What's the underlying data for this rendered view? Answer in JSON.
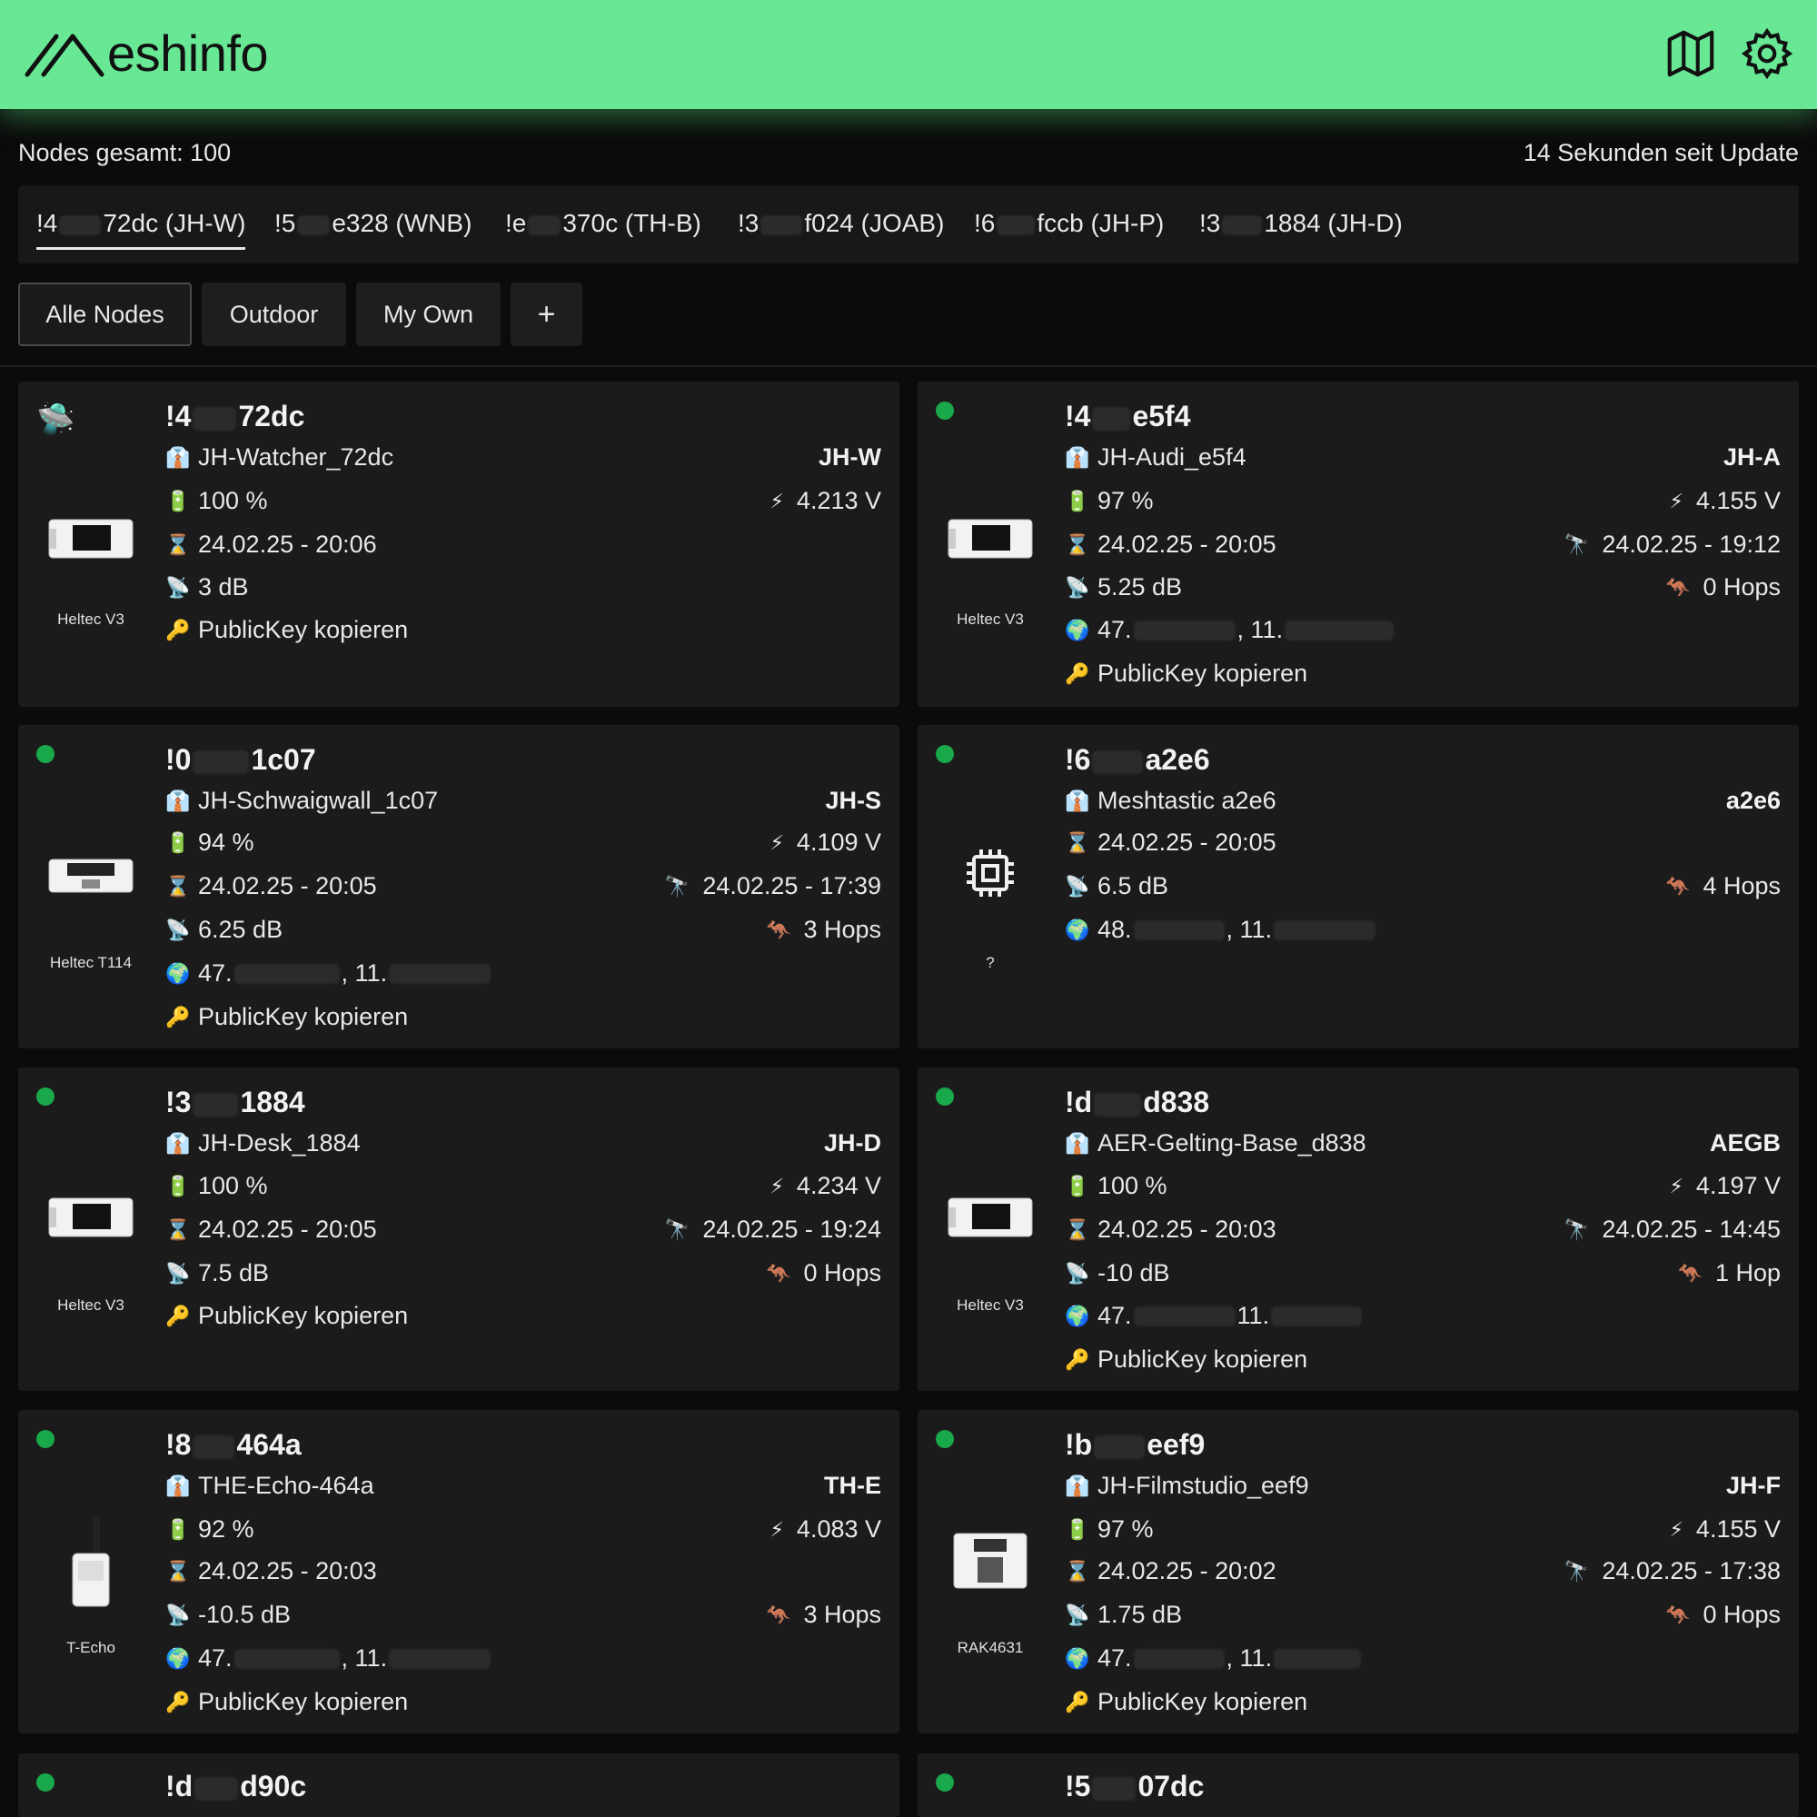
{
  "app": {
    "title": "eshinfo",
    "nodes_total": "Nodes gesamt: 100",
    "last_update": "14 Sekunden seit Update"
  },
  "icons": {
    "map": "map-icon",
    "settings": "settings-icon",
    "accent": "#68e895",
    "online": "#19a84a"
  },
  "favorites": [
    {
      "pre": "!4",
      "post": "72dc (JH-W)"
    },
    {
      "pre": "!5",
      "post": "e328 (WNB)"
    },
    {
      "pre": "!e",
      "post": "370c (TH-B)"
    },
    {
      "pre": "!3",
      "post": "f024 (JOAB)"
    },
    {
      "pre": "!6",
      "post": "fccb (JH-P)"
    },
    {
      "pre": "!3",
      "post": "1884 (JH-D)"
    }
  ],
  "filters": [
    "Alle Nodes",
    "Outdoor",
    "My Own",
    "+"
  ],
  "nodes": [
    {
      "id_pre": "!4",
      "id_post": "72dc",
      "name": "JH-Watcher_72dc",
      "short": "JH-W",
      "battery": "100 %",
      "voltage": "4.213 V",
      "last_heard": "24.02.25 - 20:06",
      "snr": "3 dB",
      "pubkey": "PublicKey kopieren",
      "device": "Heltec V3"
    },
    {
      "id_pre": "!4",
      "id_post": "e5f4",
      "name": "JH-Audi_e5f4",
      "short": "JH-A",
      "battery": "97 %",
      "voltage": "4.155 V",
      "last_heard": "24.02.25 - 20:05",
      "position_time": "24.02.25 - 19:12",
      "snr": "5.25 dB",
      "hops": "0 Hops",
      "lat": "47.",
      "lon": ", 11.",
      "pubkey": "PublicKey kopieren",
      "device": "Heltec V3"
    },
    {
      "id_pre": "!0",
      "id_post": "1c07",
      "name": "JH-Schwaigwall_1c07",
      "short": "JH-S",
      "battery": "94 %",
      "voltage": "4.109 V",
      "last_heard": "24.02.25 - 20:05",
      "position_time": "24.02.25 - 17:39",
      "snr": "6.25 dB",
      "hops": "3 Hops",
      "lat": "47.",
      "lon": ", 11.",
      "pubkey": "PublicKey kopieren",
      "device": "Heltec T114"
    },
    {
      "id_pre": "!6",
      "id_post": "a2e6",
      "name": "Meshtastic a2e6",
      "short": "a2e6",
      "last_heard": "24.02.25 - 20:05",
      "snr": "6.5 dB",
      "hops": "4 Hops",
      "lat": "48.",
      "lon": ", 11.",
      "device": "?"
    },
    {
      "id_pre": "!3",
      "id_post": "1884",
      "name": "JH-Desk_1884",
      "short": "JH-D",
      "battery": "100 %",
      "voltage": "4.234 V",
      "last_heard": "24.02.25 - 20:05",
      "position_time": "24.02.25 - 19:24",
      "snr": "7.5 dB",
      "hops": "0 Hops",
      "pubkey": "PublicKey kopieren",
      "device": "Heltec V3"
    },
    {
      "id_pre": "!d",
      "id_post": "d838",
      "name": "AER-Gelting-Base_d838",
      "short": "AEGB",
      "battery": "100 %",
      "voltage": "4.197 V",
      "last_heard": "24.02.25 - 20:03",
      "position_time": "24.02.25 - 14:45",
      "snr": "-10 dB",
      "hops": "1 Hop",
      "lat": "47.",
      "lon": " 11.",
      "pubkey": "PublicKey kopieren",
      "device": "Heltec V3"
    },
    {
      "id_pre": "!8",
      "id_post": "464a",
      "name": "THE-Echo-464a",
      "short": "TH-E",
      "battery": "92 %",
      "voltage": "4.083 V",
      "last_heard": "24.02.25 - 20:03",
      "snr": "-10.5 dB",
      "hops": "3 Hops",
      "lat": "47.",
      "lon": ", 11.",
      "pubkey": "PublicKey kopieren",
      "device": "T-Echo"
    },
    {
      "id_pre": "!b",
      "id_post": "eef9",
      "name": "JH-Filmstudio_eef9",
      "short": "JH-F",
      "battery": "97 %",
      "voltage": "4.155 V",
      "last_heard": "24.02.25 - 20:02",
      "position_time": "24.02.25 - 17:38",
      "snr": "1.75 dB",
      "hops": "0 Hops",
      "lat": "47.",
      "lon": ", 11.",
      "pubkey": "PublicKey kopieren",
      "device": "RAK4631"
    },
    {
      "id_pre": "!d",
      "id_post": "d90c"
    },
    {
      "id_pre": "!5",
      "id_post": "07dc"
    }
  ]
}
